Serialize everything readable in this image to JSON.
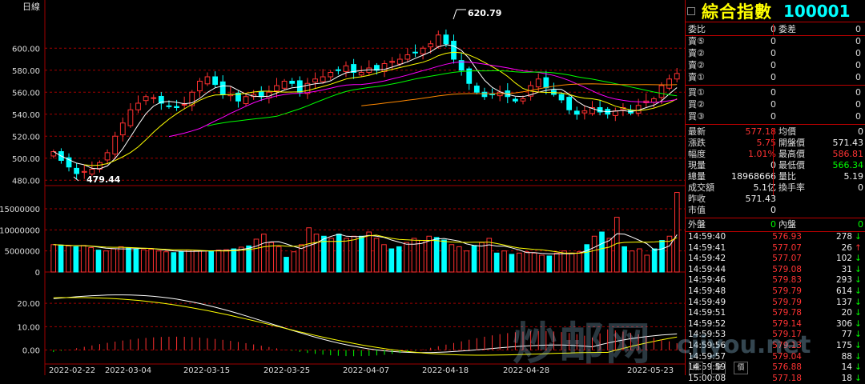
{
  "chart": {
    "period_label": "日線",
    "price_ticks": [
      "600.00",
      "580.00",
      "560.00",
      "540.00",
      "520.00",
      "500.00",
      "480.00"
    ],
    "volume_ticks": [
      "15000000",
      "10000000",
      "5000000",
      "0"
    ],
    "indicator_ticks": [
      "20.00",
      "10.00",
      "0.00"
    ],
    "high_marker": "620.79",
    "low_marker": "479.44",
    "dates": [
      "2022-02-22",
      "2022-03-04",
      "2022-03-15",
      "2022-03-25",
      "2022-04-07",
      "2022-04-18",
      "2022-04-28",
      "2022-05-23"
    ],
    "colors": {
      "up": "#ff3030",
      "down": "#00ffff",
      "ma5": "#ffffff",
      "ma10": "#ffff00",
      "ma20": "#ff00ff",
      "ma30": "#00ff00",
      "ma60": "#ff8800",
      "grid": "#a00000"
    }
  },
  "chart_data": {
    "type": "candlestick",
    "price_ylim": [
      478,
      622
    ],
    "closes": [
      506,
      498,
      492,
      486,
      488,
      490,
      496,
      505,
      520,
      532,
      544,
      550,
      556,
      555,
      550,
      547,
      546,
      549,
      560,
      570,
      574,
      567,
      558,
      558,
      552,
      556,
      558,
      556,
      560,
      566,
      570,
      568,
      560,
      568,
      572,
      574,
      578,
      580,
      584,
      578,
      578,
      582,
      580,
      586,
      588,
      590,
      594,
      596,
      600,
      604,
      612,
      604,
      590,
      580,
      568,
      560,
      556,
      558,
      560,
      556,
      552,
      554,
      566,
      572,
      564,
      558,
      553,
      544,
      540,
      543,
      546,
      542,
      540,
      543,
      546,
      541,
      548,
      552,
      554,
      566,
      572,
      577
    ],
    "volume_ylim": [
      0,
      19000000
    ],
    "volumes": [
      6.5,
      6.3,
      6.2,
      6.0,
      6.3,
      5.8,
      5.2,
      5.0,
      5.5,
      6.0,
      5.8,
      5.5,
      5.3,
      5.4,
      5.0,
      4.8,
      4.6,
      4.9,
      5.2,
      5.1,
      5.0,
      4.9,
      5.2,
      5.3,
      5.5,
      5.9,
      6.2,
      7.8,
      9.0,
      7.0,
      6.0,
      3.5,
      4.8,
      6.5,
      10.5,
      9.0,
      8.5,
      8.0,
      9.0,
      8.0,
      8.5,
      8.5,
      9.5,
      8.0,
      6.5,
      5.5,
      6.0,
      7.0,
      8.0,
      7.5,
      8.5,
      8.2,
      7.6,
      6.5,
      6.0,
      5.0,
      6.3,
      7.0,
      8.0,
      4.5,
      5.0,
      4.2,
      4.5,
      4.8,
      4.5,
      4.0,
      3.8,
      4.5,
      5.0,
      4.5,
      4.8,
      6.5,
      8.5,
      9.5,
      8.0,
      13.0,
      6.0,
      5.0,
      5.5,
      4.0,
      5.5,
      7.5,
      8.5,
      18.9
    ],
    "indicator_ylim": [
      -6,
      30
    ]
  },
  "quote": {
    "name": "綜合指數",
    "code": "100001",
    "rows": [
      {
        "l1": "委比",
        "v1": "0",
        "l2": "委差",
        "v2": "0"
      },
      {
        "l1": "賣⑤",
        "v1": "0",
        "v1b": "0"
      },
      {
        "l1": "賣②",
        "v1": "0",
        "v1b": "0"
      },
      {
        "l1": "賣②",
        "v1": "0",
        "v1b": "0"
      },
      {
        "l1": "賣①",
        "v1": "0",
        "v1b": "0"
      },
      {
        "l1": "買①",
        "v1": "0",
        "v1b": "0"
      },
      {
        "l1": "買②",
        "v1": "0",
        "v1b": "0"
      },
      {
        "l1": "買③",
        "v1": "0",
        "v1b": "0"
      }
    ],
    "stats": [
      {
        "l1": "最新",
        "v1": "577.18",
        "c1": "red",
        "l2": "均價",
        "v2": "0",
        "c2": "wht"
      },
      {
        "l1": "漲跌",
        "v1": "5.75",
        "c1": "red",
        "l2": "開盤價",
        "v2": "571.43",
        "c2": "wht"
      },
      {
        "l1": "幅度",
        "v1": "1.01%",
        "c1": "red",
        "l2": "最高價",
        "v2": "586.81",
        "c2": "red"
      },
      {
        "l1": "現量",
        "v1": "0",
        "c1": "wht",
        "l2": "最低價",
        "v2": "566.34",
        "c2": "grn"
      },
      {
        "l1": "總量",
        "v1": "18968666",
        "c1": "wht",
        "l2": "量比",
        "v2": "5.19",
        "c2": "wht"
      },
      {
        "l1": "成交額",
        "v1": "5.1亿",
        "c1": "wht",
        "l2": "換手率",
        "v2": "0",
        "c2": "wht"
      },
      {
        "l1": "昨收",
        "v1": "571.43",
        "c1": "wht",
        "l2": "",
        "v2": "",
        "c2": "wht"
      },
      {
        "l1": "市值",
        "v1": "0",
        "c1": "wht",
        "l2": "",
        "v2": "",
        "c2": "wht"
      }
    ],
    "outer_label": "外盤",
    "outer_value": "0",
    "inner_label": "內盤",
    "inner_value": "0",
    "ticks": [
      {
        "t": "14:59:40",
        "p": "576.93",
        "v": "278",
        "d": "↓"
      },
      {
        "t": "14:59:41",
        "p": "577.07",
        "v": "26",
        "d": "↑"
      },
      {
        "t": "14:59:42",
        "p": "577.07",
        "v": "102",
        "d": "↓"
      },
      {
        "t": "14:59:44",
        "p": "579.08",
        "v": "31",
        "d": "↓"
      },
      {
        "t": "14:59:46",
        "p": "579.83",
        "v": "293",
        "d": "↓"
      },
      {
        "t": "14:59:48",
        "p": "579.79",
        "v": "614",
        "d": "↓"
      },
      {
        "t": "14:59:49",
        "p": "579.79",
        "v": "137",
        "d": "↓"
      },
      {
        "t": "14:59:51",
        "p": "579.78",
        "v": "20",
        "d": "↓"
      },
      {
        "t": "14:59:52",
        "p": "579.14",
        "v": "306",
        "d": "↓"
      },
      {
        "t": "14:59:53",
        "p": "579.17",
        "v": "77",
        "d": "↓"
      },
      {
        "t": "14:59:56",
        "p": "579.13",
        "v": "175",
        "d": "↓"
      },
      {
        "t": "14:59:57",
        "p": "579.04",
        "v": "88",
        "d": "↓"
      },
      {
        "t": "14:59:59",
        "p": "576.88",
        "v": "14",
        "d": "↓"
      },
      {
        "t": "15:00:08",
        "p": "577.18",
        "v": "18",
        "d": "↓"
      }
    ],
    "tabs": [
      "細",
      "筆",
      "價"
    ]
  },
  "watermark": {
    "text1": "炒邮网",
    "text2": "cjiyou.net"
  }
}
